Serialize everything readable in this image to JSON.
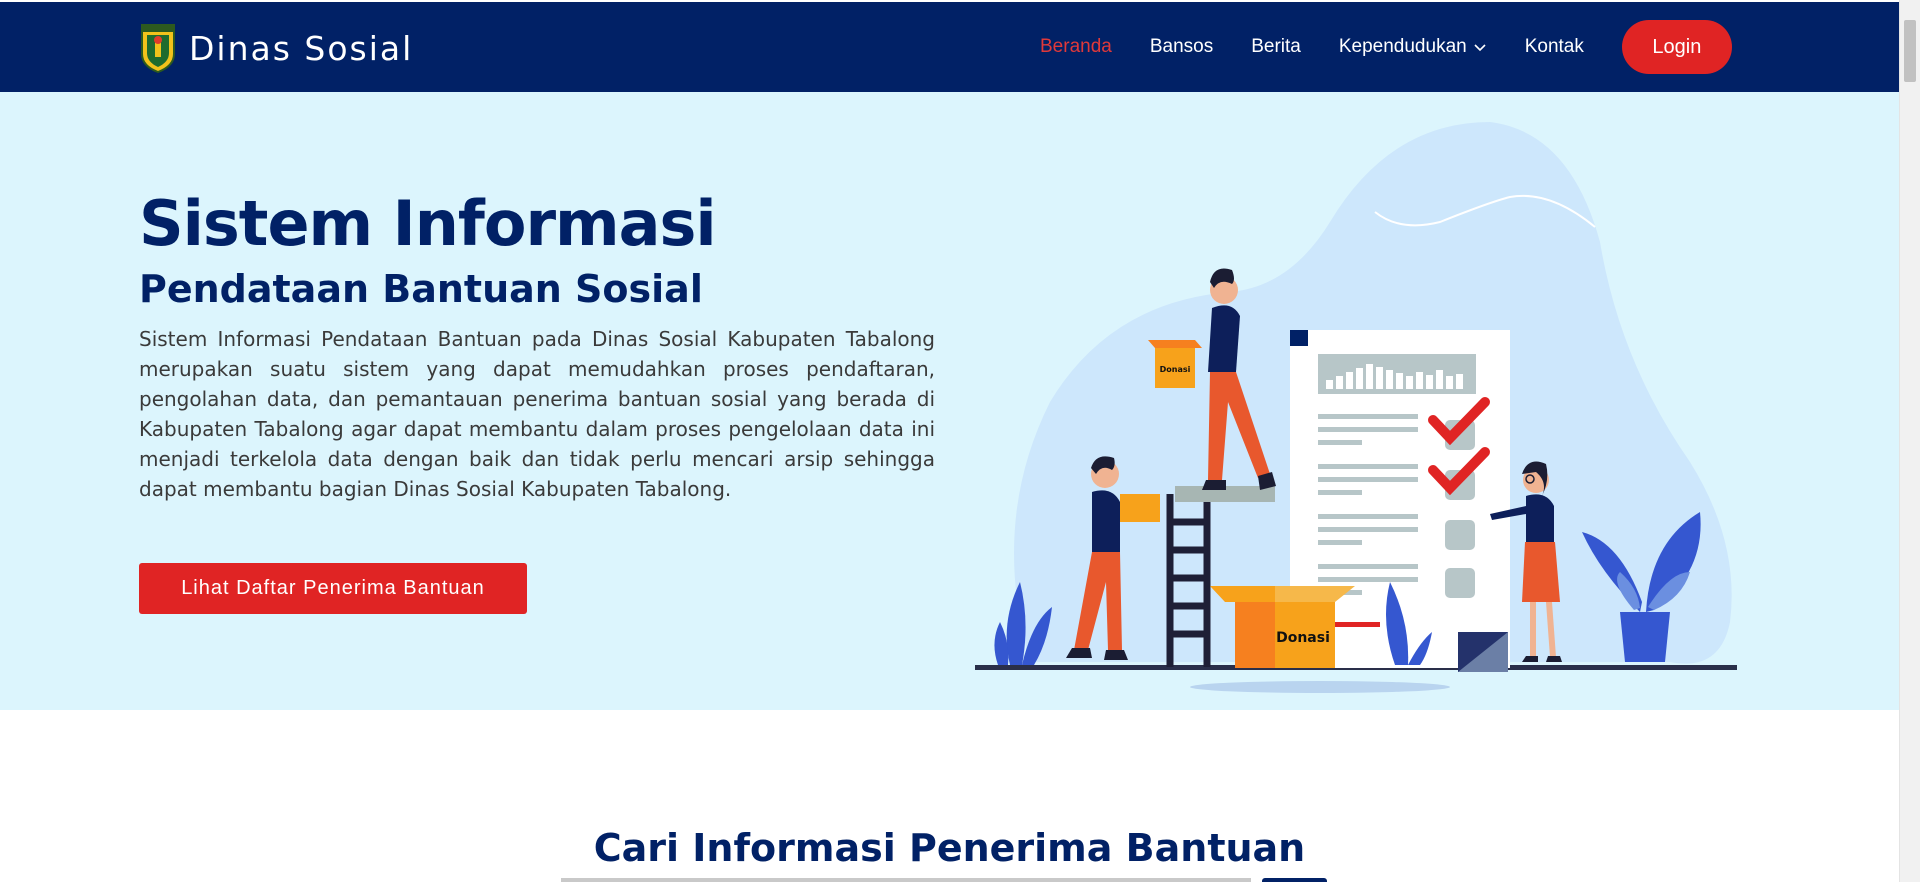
{
  "header": {
    "brand_name": "Dinas Sosial",
    "logo_icon": "tabalong-crest-icon",
    "nav": [
      {
        "label": "Beranda",
        "active": true
      },
      {
        "label": "Bansos"
      },
      {
        "label": "Berita"
      },
      {
        "label": "Kependudukan",
        "has_dropdown": true
      },
      {
        "label": "Kontak"
      }
    ],
    "login_label": "Login"
  },
  "hero": {
    "title": "Sistem Informasi",
    "subtitle": "Pendataan Bantuan Sosial",
    "description": "Sistem Informasi Pendataan Bantuan pada Dinas Sosial Kabupaten Tabalong merupakan suatu sistem yang dapat memudahkan proses pendaftaran, pengolahan data, dan pemantauan penerima bantuan sosial yang berada di Kabupaten Tabalong agar dapat membantu dalam proses pengelolaan data ini menjadi terkelola data dengan baik dan tidak perlu mencari arsip sehingga dapat membantu bagian Dinas Sosial Kabupaten Tabalong.",
    "button_label": "Lihat Daftar Penerima Bantuan",
    "illustration": {
      "box_label_small": "Donasi",
      "box_label_large": "Donasi"
    }
  },
  "search_section": {
    "title": "Cari Informasi Penerima Bantuan"
  },
  "colors": {
    "navy": "#012166",
    "red": "#e02424",
    "hero_bg": "#dcf5fd",
    "active_nav": "#e0393a"
  }
}
